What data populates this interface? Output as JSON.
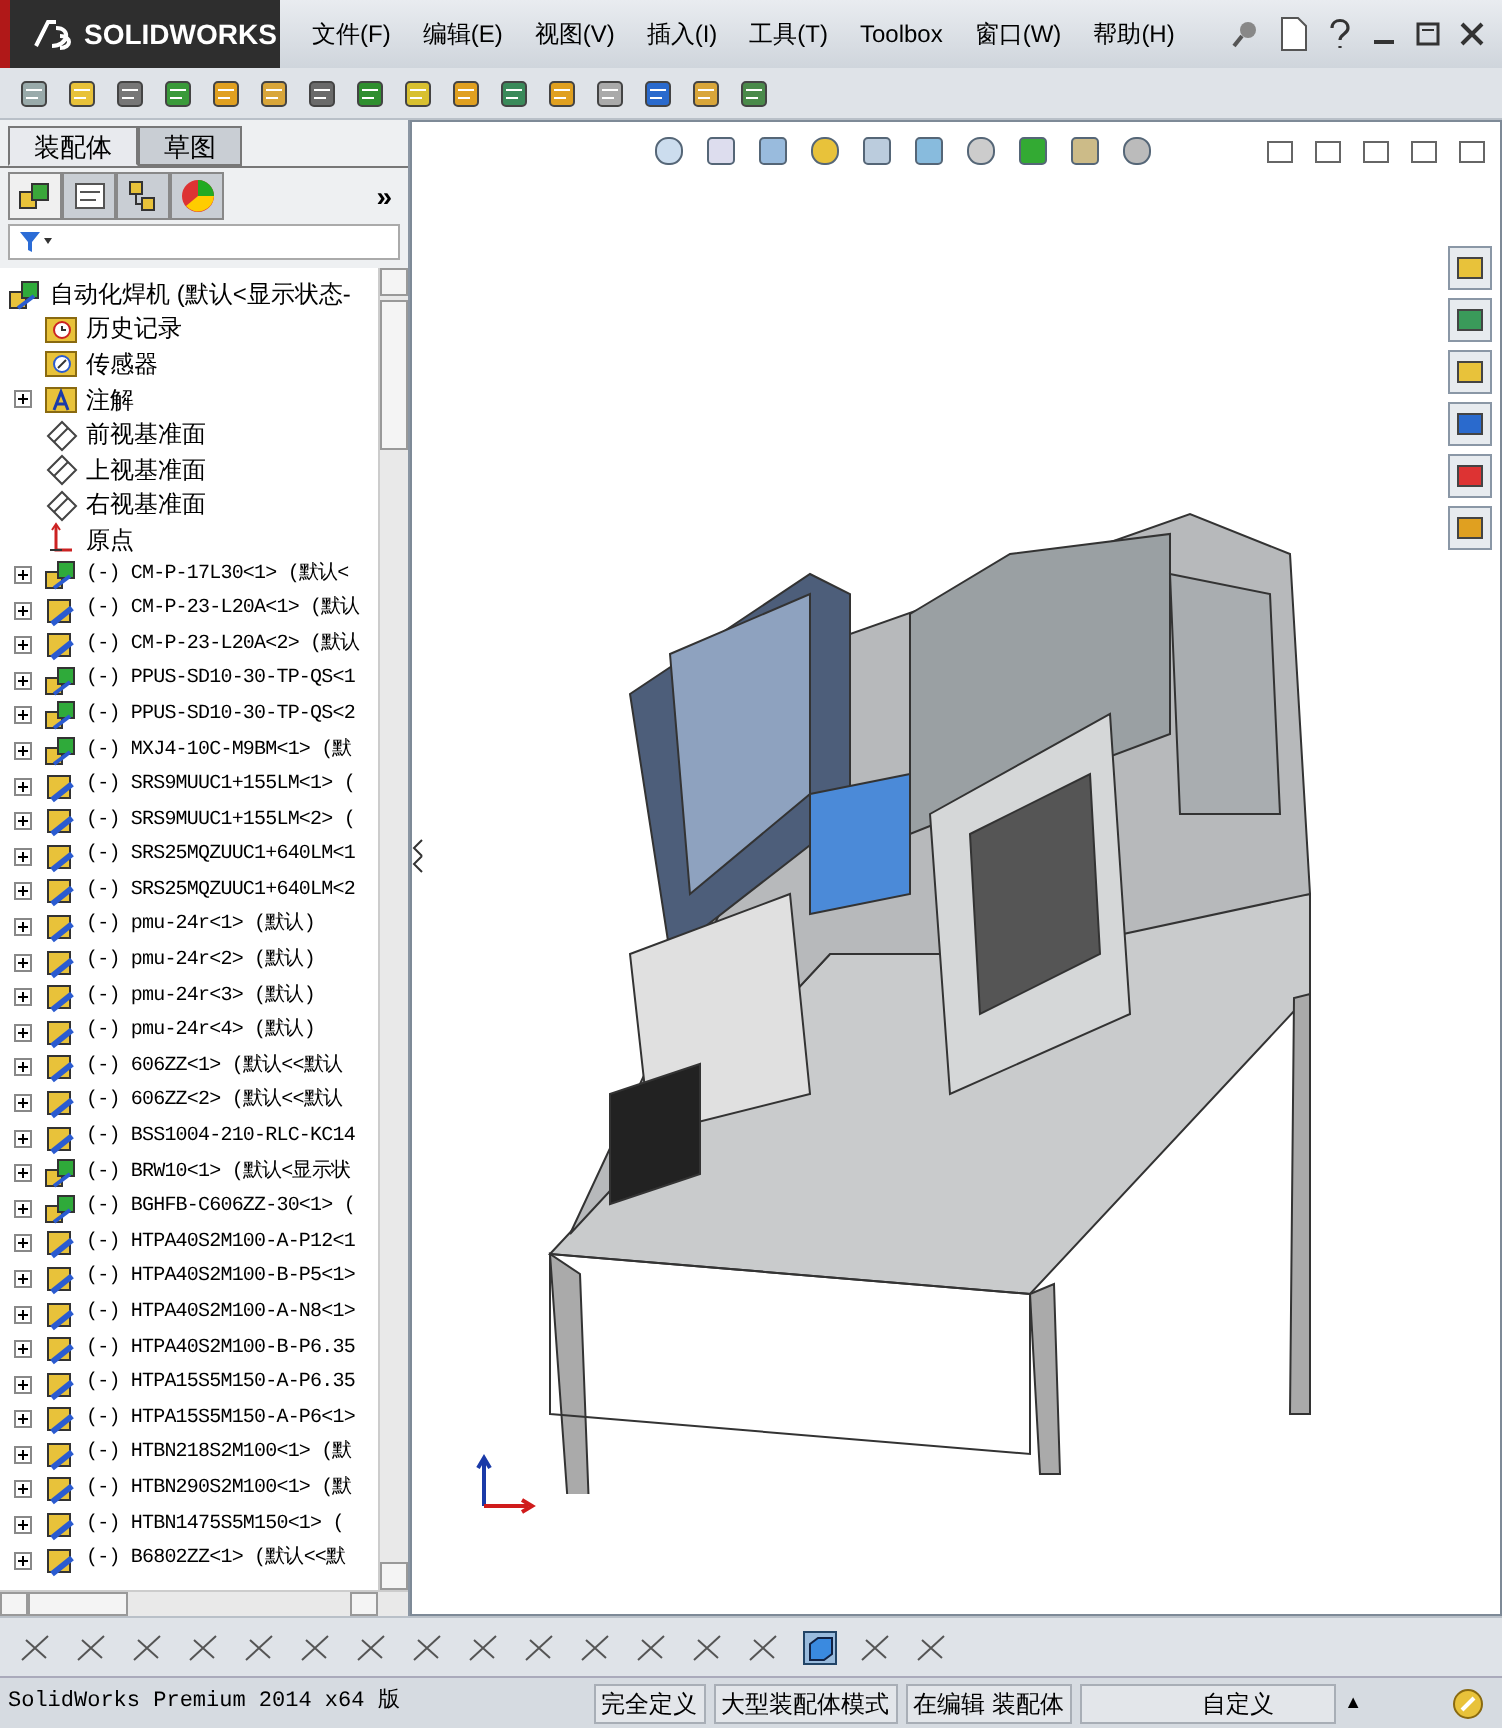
{
  "app": {
    "logo": "SOLIDWORKS",
    "menu": [
      "文件(F)",
      "编辑(E)",
      "视图(V)",
      "插入(I)",
      "工具(T)",
      "Toolbox",
      "窗口(W)",
      "帮助(H)"
    ]
  },
  "feature_manager": {
    "tabs": [
      {
        "label": "装配体",
        "selected": true
      },
      {
        "label": "草图",
        "selected": false
      }
    ],
    "panel_tabs": [
      {
        "kind": "tree",
        "selected": true
      },
      {
        "kind": "property",
        "selected": false
      },
      {
        "kind": "config",
        "selected": false
      },
      {
        "kind": "display",
        "selected": false
      }
    ],
    "more": "»",
    "tree": {
      "root": {
        "label": "自动化焊机  (默认<显示状态-"
      },
      "items": [
        {
          "kind": "history",
          "label": "历史记录",
          "collapsed": false
        },
        {
          "kind": "sensor",
          "label": "传感器",
          "collapsed": false
        },
        {
          "kind": "annotation",
          "label": "注解",
          "collapsed": true
        },
        {
          "kind": "plane",
          "label": "前视基准面",
          "collapsed": false
        },
        {
          "kind": "plane",
          "label": "上视基准面",
          "collapsed": false
        },
        {
          "kind": "plane",
          "label": "右视基准面",
          "collapsed": false
        },
        {
          "kind": "origin",
          "label": "原点",
          "collapsed": false
        },
        {
          "kind": "assembly",
          "label": "(-) CM-P-17L30<1> (默认<",
          "collapsed": true
        },
        {
          "kind": "part",
          "label": "(-) CM-P-23-L20A<1> (默认",
          "collapsed": true
        },
        {
          "kind": "part",
          "label": "(-) CM-P-23-L20A<2> (默认",
          "collapsed": true
        },
        {
          "kind": "assembly",
          "label": "(-) PPUS-SD10-30-TP-QS<1",
          "collapsed": true
        },
        {
          "kind": "assembly",
          "label": "(-) PPUS-SD10-30-TP-QS<2",
          "collapsed": true
        },
        {
          "kind": "assembly",
          "label": "(-) MXJ4-10C-M9BM<1> (默",
          "collapsed": true
        },
        {
          "kind": "part",
          "label": "(-) SRS9MUUC1+155LM<1> (",
          "collapsed": true
        },
        {
          "kind": "part",
          "label": "(-) SRS9MUUC1+155LM<2> (",
          "collapsed": true
        },
        {
          "kind": "part",
          "label": "(-) SRS25MQZUUC1+640LM<1",
          "collapsed": true
        },
        {
          "kind": "part",
          "label": "(-) SRS25MQZUUC1+640LM<2",
          "collapsed": true
        },
        {
          "kind": "part",
          "label": "(-) pmu-24r<1> (默认)",
          "collapsed": true
        },
        {
          "kind": "part",
          "label": "(-) pmu-24r<2> (默认)",
          "collapsed": true
        },
        {
          "kind": "part",
          "label": "(-) pmu-24r<3> (默认)",
          "collapsed": true
        },
        {
          "kind": "part",
          "label": "(-) pmu-24r<4> (默认)",
          "collapsed": true
        },
        {
          "kind": "part",
          "label": "(-) 606ZZ<1> (默认<<默认",
          "collapsed": true
        },
        {
          "kind": "part",
          "label": "(-) 606ZZ<2> (默认<<默认",
          "collapsed": true
        },
        {
          "kind": "part",
          "label": "(-) BSS1004-210-RLC-KC14",
          "collapsed": true
        },
        {
          "kind": "assembly",
          "label": "(-) BRW10<1> (默认<显示状",
          "collapsed": true
        },
        {
          "kind": "assembly",
          "label": "(-) BGHFB-C606ZZ-30<1> (",
          "collapsed": true
        },
        {
          "kind": "part",
          "label": "(-) HTPA40S2M100-A-P12<1",
          "collapsed": true
        },
        {
          "kind": "part",
          "label": "(-) HTPA40S2M100-B-P5<1>",
          "collapsed": true
        },
        {
          "kind": "part",
          "label": "(-) HTPA40S2M100-A-N8<1>",
          "collapsed": true
        },
        {
          "kind": "part",
          "label": "(-) HTPA40S2M100-B-P6.35",
          "collapsed": true
        },
        {
          "kind": "part",
          "label": "(-) HTPA15S5M150-A-P6.35",
          "collapsed": true
        },
        {
          "kind": "part",
          "label": "(-) HTPA15S5M150-A-P6<1>",
          "collapsed": true
        },
        {
          "kind": "part",
          "label": "(-) HTBN218S2M100<1> (默",
          "collapsed": true
        },
        {
          "kind": "part",
          "label": "(-) HTBN290S2M100<1> (默",
          "collapsed": true
        },
        {
          "kind": "part",
          "label": "(-) HTBN1475S5M150<1> (",
          "collapsed": true
        },
        {
          "kind": "part",
          "label": "(-) B6802ZZ<1> (默认<<默",
          "collapsed": true
        }
      ]
    }
  },
  "status_bar": {
    "product": "SolidWorks Premium 2014 x64 版",
    "fields": [
      "完全定义",
      "大型装配体模式",
      "在编辑 装配体"
    ],
    "units": "自定义",
    "caret": "▲"
  }
}
